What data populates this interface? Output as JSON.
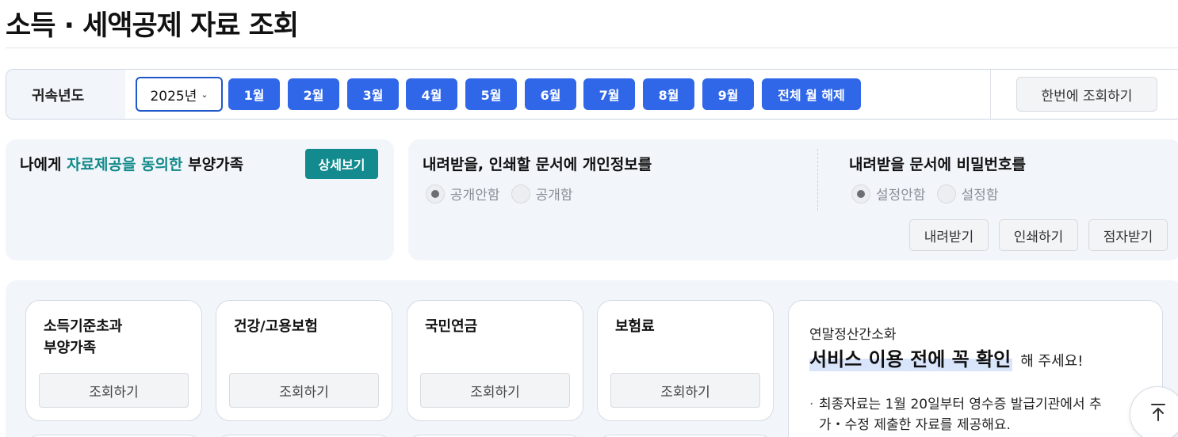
{
  "page": {
    "title": "소득 · 세액공제 자료 조회"
  },
  "filter": {
    "label": "귀속년도",
    "year": "2025년",
    "months": [
      "1월",
      "2월",
      "3월",
      "4월",
      "5월",
      "6월",
      "7월",
      "8월",
      "9월"
    ],
    "clear_all": "전체 월 해제",
    "query_all": "한번에 조회하기"
  },
  "dependents": {
    "title_prefix": "나에게 ",
    "title_highlight": "자료제공을 동의한",
    "title_suffix": " 부양가족",
    "detail_button": "상세보기"
  },
  "download": {
    "privacy_title": "내려받을, 인쇄할 문서에 개인정보를",
    "privacy_options": [
      "공개안함",
      "공개함"
    ],
    "privacy_selected": "공개안함",
    "password_title": "내려받을 문서에 비밀번호를",
    "password_options": [
      "설정안함",
      "설정함"
    ],
    "password_selected": "설정안함",
    "buttons": [
      "내려받기",
      "인쇄하기",
      "점자받기"
    ]
  },
  "items": [
    {
      "title": "소득기준초과\n부양가족",
      "button": "조회하기"
    },
    {
      "title": "건강/고용보험",
      "button": "조회하기"
    },
    {
      "title": "국민연금",
      "button": "조회하기"
    },
    {
      "title": "보험료",
      "button": "조회하기"
    }
  ],
  "notice": {
    "subtitle": "연말정산간소화",
    "headline_strong": "서비스 이용 전에 꼭 확인",
    "headline_rest": "해 주세요!",
    "bullet": "·",
    "text": "최종자료는 1월 20일부터 영수증 발급기관에서 추가・수정 제출한 자료를 제공해요."
  },
  "icons": {
    "scroll_top": "arrow-up-to-line-icon",
    "chevron": "chevron-down-icon"
  },
  "colors": {
    "primary": "#2f67e8",
    "teal": "#128a8e",
    "panel_bg": "#f2f6fb"
  }
}
